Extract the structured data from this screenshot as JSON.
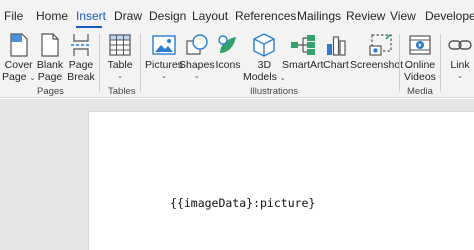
{
  "tabs": [
    {
      "label": "File"
    },
    {
      "label": "Home"
    },
    {
      "label": "Insert",
      "active": true
    },
    {
      "label": "Draw"
    },
    {
      "label": "Design"
    },
    {
      "label": "Layout"
    },
    {
      "label": "References"
    },
    {
      "label": "Mailings"
    },
    {
      "label": "Review"
    },
    {
      "label": "View"
    },
    {
      "label": "Developer"
    }
  ],
  "ribbon": {
    "pages": {
      "group_label": "Pages",
      "cover_page": [
        "Cover",
        "Page"
      ],
      "blank_page": [
        "Blank",
        "Page"
      ],
      "page_break": [
        "Page",
        "Break"
      ]
    },
    "tables": {
      "group_label": "Tables",
      "table": "Table"
    },
    "illustrations": {
      "group_label": "Illustrations",
      "pictures": "Pictures",
      "shapes": "Shapes",
      "icons": "Icons",
      "models_3d": [
        "3D",
        "Models"
      ],
      "smartart": "SmartArt",
      "chart": "Chart",
      "screenshot": "Screenshot"
    },
    "media": {
      "group_label": "Media",
      "online_videos": [
        "Online",
        "Videos"
      ]
    },
    "links": {
      "link": "Link"
    }
  },
  "document": {
    "content": "{{imageData}:picture}"
  },
  "colors": {
    "accent": "#185abd",
    "ribbon_bg": "#f3f3f3",
    "workspace_bg": "#e6e6e6",
    "icon_blue": "#2b7cd3",
    "icon_green": "#33a36b"
  }
}
